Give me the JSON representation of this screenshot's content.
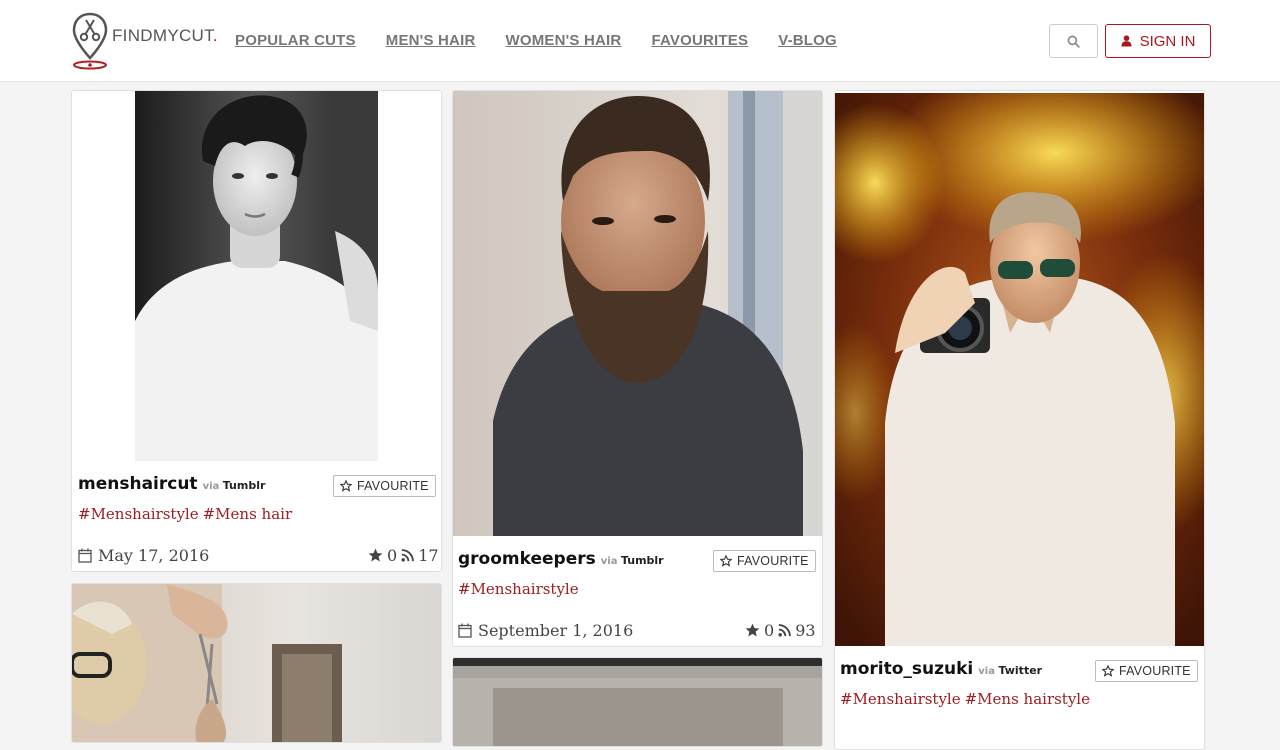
{
  "brand": {
    "logo_text": "FINDMYCUT",
    "logo_dot": ".",
    "accent": "#a8191e"
  },
  "nav": [
    {
      "label": "POPULAR CUTS"
    },
    {
      "label": "MEN'S HAIR"
    },
    {
      "label": "WOMEN'S HAIR"
    },
    {
      "label": "FAVOURITES"
    },
    {
      "label": "V-BLOG"
    }
  ],
  "header": {
    "search_icon": "search-icon",
    "signin_label": "SIGN IN",
    "signin_icon": "user-icon"
  },
  "cards": [
    {
      "user": "menshaircut",
      "via": "via",
      "source": "Tumblr",
      "favourite_label": "FAVOURITE",
      "tags": [
        "#Menshairstyle",
        "#Mens hair"
      ],
      "date": "May 17, 2016",
      "stars": "0",
      "feeds": "17"
    },
    {
      "user": "groomkeepers",
      "via": "via",
      "source": "Tumblr",
      "favourite_label": "FAVOURITE",
      "tags": [
        "#Menshairstyle"
      ],
      "date": "September 1, 2016",
      "stars": "0",
      "feeds": "93"
    },
    {
      "user": "morito_suzuki",
      "via": "via",
      "source": "Twitter",
      "favourite_label": "FAVOURITE",
      "tags": [
        "#Menshairstyle",
        "#Mens hairstyle"
      ]
    }
  ]
}
